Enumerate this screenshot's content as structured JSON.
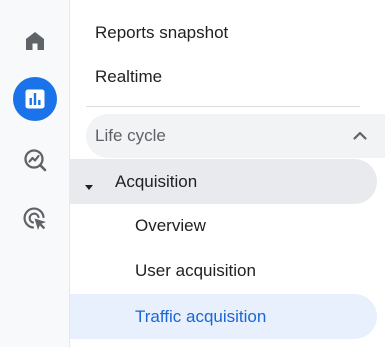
{
  "rail": {
    "items": [
      {
        "name": "Home",
        "icon": "home-icon"
      },
      {
        "name": "Reports",
        "icon": "reports-icon",
        "active": true
      },
      {
        "name": "Explore",
        "icon": "explore-icon"
      },
      {
        "name": "Advertising",
        "icon": "advertising-icon"
      }
    ],
    "active_color": "#1a73e8"
  },
  "nav": {
    "reports_snapshot": "Reports snapshot",
    "realtime": "Realtime",
    "life_cycle": {
      "label": "Life cycle",
      "expanded": true,
      "acquisition": {
        "label": "Acquisition",
        "expanded": true,
        "items": [
          "Overview",
          "User acquisition",
          "Traffic acquisition"
        ],
        "selected": "Traffic acquisition"
      }
    }
  },
  "colors": {
    "selected_text": "#1967d2",
    "selected_bg": "#e8f0fe"
  }
}
